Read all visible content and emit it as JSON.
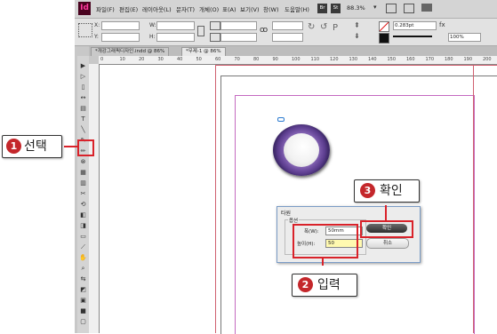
{
  "app": {
    "logo": "Id"
  },
  "menubar": {
    "items": [
      "파일(F)",
      "편집(E)",
      "레이아웃(L)",
      "문자(T)",
      "개체(O)",
      "표(A)",
      "보기(V)",
      "창(W)",
      "도움말(H)"
    ],
    "br_label": "Br",
    "st_label": "St",
    "zoom": "88.3%"
  },
  "control": {
    "x_label": "X:",
    "y_label": "Y:",
    "w_label": "W:",
    "h_label": "H:",
    "stroke_weight": "0.283pt",
    "opacity": "100%"
  },
  "tabs": [
    {
      "label": "*개강그래픽디자인.indd @ 86%"
    },
    {
      "label": "*무제-1 @ 86%"
    }
  ],
  "ruler": {
    "ticks": [
      "0",
      "10",
      "20",
      "30",
      "40",
      "50",
      "60",
      "70",
      "80",
      "90",
      "100",
      "110",
      "120",
      "130",
      "140",
      "150",
      "160",
      "170",
      "180",
      "190",
      "200"
    ]
  },
  "dialog": {
    "title": "타원",
    "group_label": "옵션",
    "width_label": "폭(W):",
    "width_value": "50mm",
    "height_label": "높이(H):",
    "height_value": "50",
    "ok_label": "확인",
    "cancel_label": "취소"
  },
  "callouts": {
    "step1": {
      "num": "1",
      "text": "선택"
    },
    "step2": {
      "num": "2",
      "text": "입력"
    },
    "step3": {
      "num": "3",
      "text": "확인"
    }
  },
  "colors": {
    "accent_red": "#d9222a",
    "ring_purple": "#6a4a9c",
    "indesign_brand": "#49021f"
  }
}
